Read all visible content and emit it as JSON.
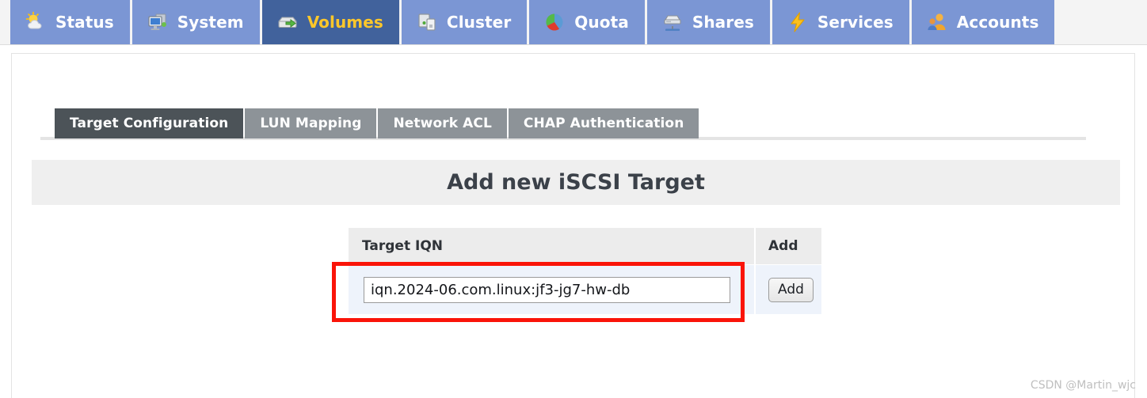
{
  "topnav": {
    "tabs": [
      {
        "label": "Status",
        "icon": "sun-cloud-icon",
        "active": false
      },
      {
        "label": "System",
        "icon": "monitor-icon",
        "active": false
      },
      {
        "label": "Volumes",
        "icon": "disk-arrow-icon",
        "active": true
      },
      {
        "label": "Cluster",
        "icon": "servers-icon",
        "active": false
      },
      {
        "label": "Quota",
        "icon": "pie-chart-icon",
        "active": false
      },
      {
        "label": "Shares",
        "icon": "share-box-icon",
        "active": false
      },
      {
        "label": "Services",
        "icon": "lightning-icon",
        "active": false
      },
      {
        "label": "Accounts",
        "icon": "users-icon",
        "active": false
      }
    ]
  },
  "subtabs": [
    {
      "label": "Target Configuration",
      "active": true
    },
    {
      "label": "LUN Mapping",
      "active": false
    },
    {
      "label": "Network ACL",
      "active": false
    },
    {
      "label": "CHAP Authentication",
      "active": false
    }
  ],
  "section": {
    "heading": "Add new iSCSI Target"
  },
  "form": {
    "columns": {
      "iqn": "Target IQN",
      "add": "Add"
    },
    "iqn_value": "iqn.2024-06.com.linux:jf3-jg7-hw-db",
    "iqn_placeholder": "",
    "add_button_label": "Add"
  },
  "watermark": "CSDN @Martin_wjc",
  "colors": {
    "nav_inactive": "#7b96d4",
    "nav_active": "#41629c",
    "nav_active_text": "#fdc72a",
    "subtab_inactive": "#8d9398",
    "subtab_active": "#4c5358",
    "heading_bg": "#efefef",
    "row_bg": "#eef3fb",
    "annotation_red": "#fa1409"
  }
}
